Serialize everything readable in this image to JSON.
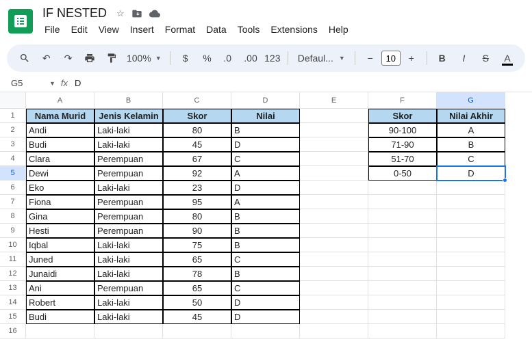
{
  "doc_title": "IF NESTED",
  "menu": [
    "File",
    "Edit",
    "View",
    "Insert",
    "Format",
    "Data",
    "Tools",
    "Extensions",
    "Help"
  ],
  "toolbar": {
    "zoom": "100%",
    "font": "Defaul...",
    "font_size": "10"
  },
  "name_box": "G5",
  "formula": "D",
  "cols": [
    "A",
    "B",
    "C",
    "D",
    "E",
    "F",
    "G"
  ],
  "active_col": "G",
  "active_row": 5,
  "headers1": {
    "A": "Nama Murid",
    "B": "Jenis Kelamin",
    "C": "Skor",
    "D": "Nilai"
  },
  "headers2": {
    "F": "Skor",
    "G": "Nilai Akhir"
  },
  "data": [
    {
      "A": "Andi",
      "B": "Laki-laki",
      "C": "80",
      "D": "B"
    },
    {
      "A": "Budi",
      "B": "Laki-laki",
      "C": "45",
      "D": "D"
    },
    {
      "A": "Clara",
      "B": "Perempuan",
      "C": "67",
      "D": "C"
    },
    {
      "A": "Dewi",
      "B": "Perempuan",
      "C": "92",
      "D": "A"
    },
    {
      "A": "Eko",
      "B": "Laki-laki",
      "C": "23",
      "D": "D"
    },
    {
      "A": "Fiona",
      "B": "Perempuan",
      "C": "95",
      "D": "A"
    },
    {
      "A": "Gina",
      "B": "Perempuan",
      "C": "80",
      "D": "B"
    },
    {
      "A": "Hesti",
      "B": "Perempuan",
      "C": "90",
      "D": "B"
    },
    {
      "A": "Iqbal",
      "B": "Laki-laki",
      "C": "75",
      "D": "B"
    },
    {
      "A": "Juned",
      "B": "Laki-laki",
      "C": "65",
      "D": "C"
    },
    {
      "A": "Junaidi",
      "B": "Laki-laki",
      "C": "78",
      "D": "B"
    },
    {
      "A": "Ani",
      "B": "Perempuan",
      "C": "65",
      "D": "C"
    },
    {
      "A": "Robert",
      "B": "Laki-laki",
      "C": "50",
      "D": "D"
    },
    {
      "A": "Budi",
      "B": "Laki-laki",
      "C": "45",
      "D": "D"
    }
  ],
  "lookup": [
    {
      "F": "90-100",
      "G": "A"
    },
    {
      "F": "71-90",
      "G": "B"
    },
    {
      "F": "51-70",
      "G": "C"
    },
    {
      "F": "0-50",
      "G": "D"
    }
  ]
}
